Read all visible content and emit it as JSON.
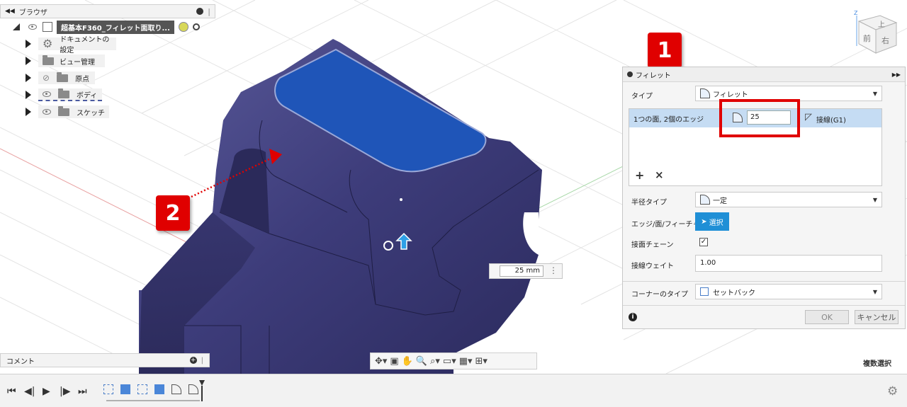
{
  "browser": {
    "title": "ブラウザ",
    "document_name": "超基本F360_フィレット面取り...",
    "items": [
      {
        "label": "ドキュメントの設定"
      },
      {
        "label": "ビュー管理"
      },
      {
        "label": "原点"
      },
      {
        "label": "ボディ"
      },
      {
        "label": "スケッチ"
      }
    ]
  },
  "comment": {
    "title": "コメント"
  },
  "viewcube": {
    "top": "上",
    "front": "前",
    "right": "右",
    "axis_z": "Z"
  },
  "dialog": {
    "title": "フィレット",
    "type_label": "タイプ",
    "type_value": "フィレット",
    "selection_text": "1つの面, 2個のエッジ",
    "radius_value": "25",
    "continuity": "接線(G1)",
    "add": "+",
    "remove": "×",
    "radius_type_label": "半径タイプ",
    "radius_type_value": "一定",
    "edge_label": "エッジ/面/フィーチャ",
    "select_button": "選択",
    "tangent_chain_label": "接面チェーン",
    "tangent_chain_checked": "✓",
    "tangent_weight_label": "接線ウェイト",
    "tangent_weight_value": "1.00",
    "corner_type_label": "コーナーのタイプ",
    "corner_type_value": "セットバック",
    "ok": "OK",
    "cancel": "キャンセル",
    "info": "i"
  },
  "dimension_input": "25 mm",
  "status_text": "複数選択",
  "badges": {
    "one": "1",
    "two": "2"
  },
  "colors": {
    "body": "#3d3c7a",
    "face_selected": "#1f55b8",
    "highlight": "#e00000",
    "select_button": "#1f8fd6"
  }
}
